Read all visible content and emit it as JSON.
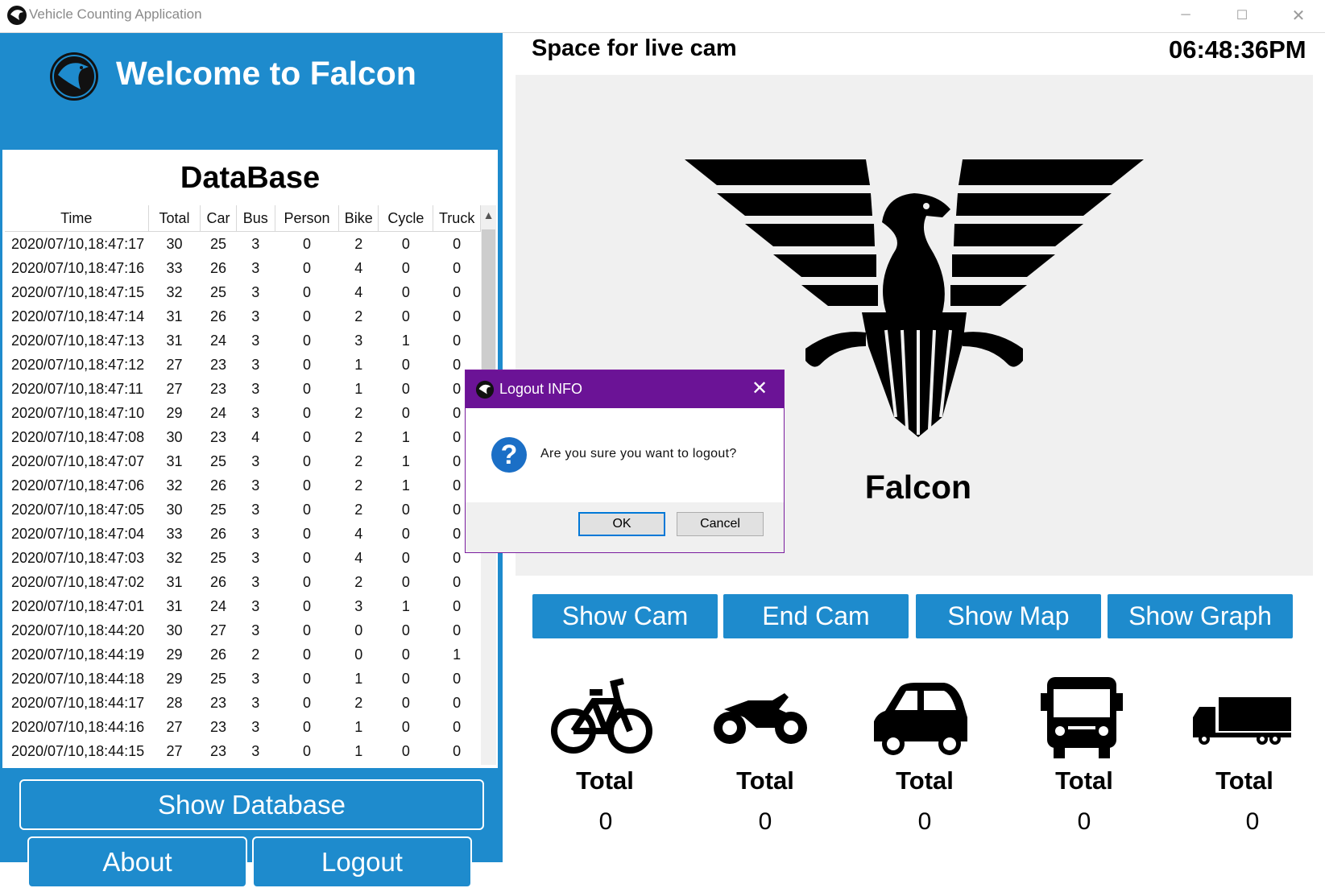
{
  "window": {
    "title": "Vehicle Counting Application",
    "controls": [
      "─",
      "☐",
      "✕"
    ]
  },
  "header": {
    "welcome": "Welcome to Falcon"
  },
  "database": {
    "title": "DataBase",
    "columns": [
      "Time",
      "Total",
      "Car",
      "Bus",
      "Person",
      "Bike",
      "Cycle",
      "Truck"
    ],
    "rows": [
      [
        "2020/07/10,18:47:17",
        "30",
        "25",
        "3",
        "0",
        "2",
        "0",
        "0"
      ],
      [
        "2020/07/10,18:47:16",
        "33",
        "26",
        "3",
        "0",
        "4",
        "0",
        "0"
      ],
      [
        "2020/07/10,18:47:15",
        "32",
        "25",
        "3",
        "0",
        "4",
        "0",
        "0"
      ],
      [
        "2020/07/10,18:47:14",
        "31",
        "26",
        "3",
        "0",
        "2",
        "0",
        "0"
      ],
      [
        "2020/07/10,18:47:13",
        "31",
        "24",
        "3",
        "0",
        "3",
        "1",
        "0"
      ],
      [
        "2020/07/10,18:47:12",
        "27",
        "23",
        "3",
        "0",
        "1",
        "0",
        "0"
      ],
      [
        "2020/07/10,18:47:11",
        "27",
        "23",
        "3",
        "0",
        "1",
        "0",
        "0"
      ],
      [
        "2020/07/10,18:47:10",
        "29",
        "24",
        "3",
        "0",
        "2",
        "0",
        "0"
      ],
      [
        "2020/07/10,18:47:08",
        "30",
        "23",
        "4",
        "0",
        "2",
        "1",
        "0"
      ],
      [
        "2020/07/10,18:47:07",
        "31",
        "25",
        "3",
        "0",
        "2",
        "1",
        "0"
      ],
      [
        "2020/07/10,18:47:06",
        "32",
        "26",
        "3",
        "0",
        "2",
        "1",
        "0"
      ],
      [
        "2020/07/10,18:47:05",
        "30",
        "25",
        "3",
        "0",
        "2",
        "0",
        "0"
      ],
      [
        "2020/07/10,18:47:04",
        "33",
        "26",
        "3",
        "0",
        "4",
        "0",
        "0"
      ],
      [
        "2020/07/10,18:47:03",
        "32",
        "25",
        "3",
        "0",
        "4",
        "0",
        "0"
      ],
      [
        "2020/07/10,18:47:02",
        "31",
        "26",
        "3",
        "0",
        "2",
        "0",
        "0"
      ],
      [
        "2020/07/10,18:47:01",
        "31",
        "24",
        "3",
        "0",
        "3",
        "1",
        "0"
      ],
      [
        "2020/07/10,18:44:20",
        "30",
        "27",
        "3",
        "0",
        "0",
        "0",
        "0"
      ],
      [
        "2020/07/10,18:44:19",
        "29",
        "26",
        "2",
        "0",
        "0",
        "0",
        "1"
      ],
      [
        "2020/07/10,18:44:18",
        "29",
        "25",
        "3",
        "0",
        "1",
        "0",
        "0"
      ],
      [
        "2020/07/10,18:44:17",
        "28",
        "23",
        "3",
        "0",
        "2",
        "0",
        "0"
      ],
      [
        "2020/07/10,18:44:16",
        "27",
        "23",
        "3",
        "0",
        "1",
        "0",
        "0"
      ],
      [
        "2020/07/10,18:44:15",
        "27",
        "23",
        "3",
        "0",
        "1",
        "0",
        "0"
      ]
    ]
  },
  "left_buttons": {
    "show_database": "Show Database",
    "about": "About",
    "logout": "Logout"
  },
  "cam": {
    "label": "Space for live cam",
    "clock": "06:48:36PM",
    "brand": "Falcon"
  },
  "cam_buttons": {
    "show_cam": "Show Cam",
    "end_cam": "End Cam",
    "show_map": "Show Map",
    "show_graph": "Show Graph"
  },
  "totals": [
    {
      "icon": "bicycle-icon",
      "label": "Total",
      "value": "0"
    },
    {
      "icon": "motorbike-icon",
      "label": "Total",
      "value": "0"
    },
    {
      "icon": "car-icon",
      "label": "Total",
      "value": "0"
    },
    {
      "icon": "bus-icon",
      "label": "Total",
      "value": "0"
    },
    {
      "icon": "truck-icon",
      "label": "Total",
      "value": "0"
    }
  ],
  "dialog": {
    "title": "Logout INFO",
    "message": "Are you sure you want to logout?",
    "ok": "OK",
    "cancel": "Cancel",
    "close": "✕",
    "question_glyph": "?"
  },
  "colors": {
    "primary": "#1e8bcd",
    "dialog_title": "#6b1396",
    "cam_bg": "#f0f0f0"
  }
}
